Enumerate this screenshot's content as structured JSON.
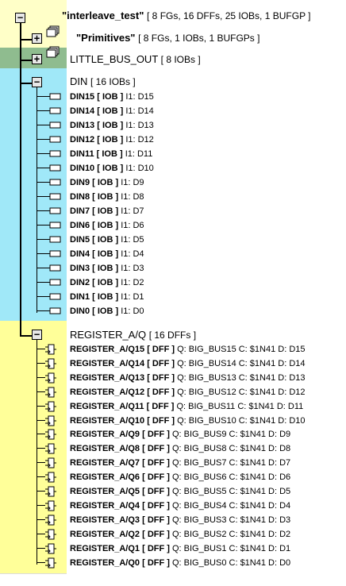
{
  "root": {
    "name": "\"interleave_test\"",
    "summary": "[ 8 FGs, 16 DFFs, 25 IOBs, 1 BUFGP ]",
    "toggle": "−"
  },
  "groups": [
    {
      "name": "\"Primitives\"",
      "summary": "[ 8 FGs, 1 IOBs, 1 BUFGPs ]",
      "toggle": "+"
    },
    {
      "name": "LITTLE_BUS_OUT",
      "summary": "[ 8 IOBs ]",
      "toggle": "+"
    },
    {
      "name": "DIN",
      "summary": "[ 16 IOBs ]",
      "toggle": "−"
    },
    {
      "name": "REGISTER_A/Q",
      "summary": "[ 16 DFFs ]",
      "toggle": "−"
    }
  ],
  "din_rows": [
    {
      "name": "DIN15",
      "type": "[ IOB ]",
      "info": "I1: D15"
    },
    {
      "name": "DIN14",
      "type": "[ IOB ]",
      "info": "I1: D14"
    },
    {
      "name": "DIN13",
      "type": "[ IOB ]",
      "info": "I1: D13"
    },
    {
      "name": "DIN12",
      "type": "[ IOB ]",
      "info": "I1: D12"
    },
    {
      "name": "DIN11",
      "type": "[ IOB ]",
      "info": "I1: D11"
    },
    {
      "name": "DIN10",
      "type": "[ IOB ]",
      "info": "I1: D10"
    },
    {
      "name": "DIN9",
      "type": "[ IOB ]",
      "info": "I1: D9"
    },
    {
      "name": "DIN8",
      "type": "[ IOB ]",
      "info": "I1: D8"
    },
    {
      "name": "DIN7",
      "type": "[ IOB ]",
      "info": "I1: D7"
    },
    {
      "name": "DIN6",
      "type": "[ IOB ]",
      "info": "I1: D6"
    },
    {
      "name": "DIN5",
      "type": "[ IOB ]",
      "info": "I1: D5"
    },
    {
      "name": "DIN4",
      "type": "[ IOB ]",
      "info": "I1: D4"
    },
    {
      "name": "DIN3",
      "type": "[ IOB ]",
      "info": "I1: D3"
    },
    {
      "name": "DIN2",
      "type": "[ IOB ]",
      "info": "I1: D2"
    },
    {
      "name": "DIN1",
      "type": "[ IOB ]",
      "info": "I1: D1"
    },
    {
      "name": "DIN0",
      "type": "[ IOB ]",
      "info": "I1: D0"
    }
  ],
  "reg_rows": [
    {
      "name": "REGISTER_A/Q15",
      "type": "[ DFF ]",
      "info": "Q: BIG_BUS15 C: $1N41 D: D15"
    },
    {
      "name": "REGISTER_A/Q14",
      "type": "[ DFF ]",
      "info": "Q: BIG_BUS14 C: $1N41 D: D14"
    },
    {
      "name": "REGISTER_A/Q13",
      "type": "[ DFF ]",
      "info": "Q: BIG_BUS13 C: $1N41 D: D13"
    },
    {
      "name": "REGISTER_A/Q12",
      "type": "[ DFF ]",
      "info": "Q: BIG_BUS12 C: $1N41 D: D12"
    },
    {
      "name": "REGISTER_A/Q11",
      "type": "[ DFF ]",
      "info": "Q: BIG_BUS11 C: $1N41 D: D11"
    },
    {
      "name": "REGISTER_A/Q10",
      "type": "[ DFF ]",
      "info": "Q: BIG_BUS10 C: $1N41 D: D10"
    },
    {
      "name": "REGISTER_A/Q9",
      "type": "[ DFF ]",
      "info": "Q: BIG_BUS9 C: $1N41 D: D9"
    },
    {
      "name": "REGISTER_A/Q8",
      "type": "[ DFF ]",
      "info": "Q: BIG_BUS8 C: $1N41 D: D8"
    },
    {
      "name": "REGISTER_A/Q7",
      "type": "[ DFF ]",
      "info": "Q: BIG_BUS7 C: $1N41 D: D7"
    },
    {
      "name": "REGISTER_A/Q6",
      "type": "[ DFF ]",
      "info": "Q: BIG_BUS6 C: $1N41 D: D6"
    },
    {
      "name": "REGISTER_A/Q5",
      "type": "[ DFF ]",
      "info": "Q: BIG_BUS5 C: $1N41 D: D5"
    },
    {
      "name": "REGISTER_A/Q4",
      "type": "[ DFF ]",
      "info": "Q: BIG_BUS4 C: $1N41 D: D4"
    },
    {
      "name": "REGISTER_A/Q3",
      "type": "[ DFF ]",
      "info": "Q: BIG_BUS3 C: $1N41 D: D3"
    },
    {
      "name": "REGISTER_A/Q2",
      "type": "[ DFF ]",
      "info": "Q: BIG_BUS2 C: $1N41 D: D2"
    },
    {
      "name": "REGISTER_A/Q1",
      "type": "[ DFF ]",
      "info": "Q: BIG_BUS1 C: $1N41 D: D1"
    },
    {
      "name": "REGISTER_A/Q0",
      "type": "[ DFF ]",
      "info": "Q: BIG_BUS0 C: $1N41 D: D0"
    }
  ],
  "colors": {
    "root_band": "#ffffc8",
    "little_band": "#8fbc8f",
    "din_band": "#a0e8f8",
    "reg_band": "#ffff99"
  },
  "icons": {
    "collapse": "minus-box-icon",
    "expand": "plus-box-icon",
    "folder": "folder-stack-icon",
    "iob": "iob-pad-icon",
    "dff": "flip-flop-icon"
  }
}
